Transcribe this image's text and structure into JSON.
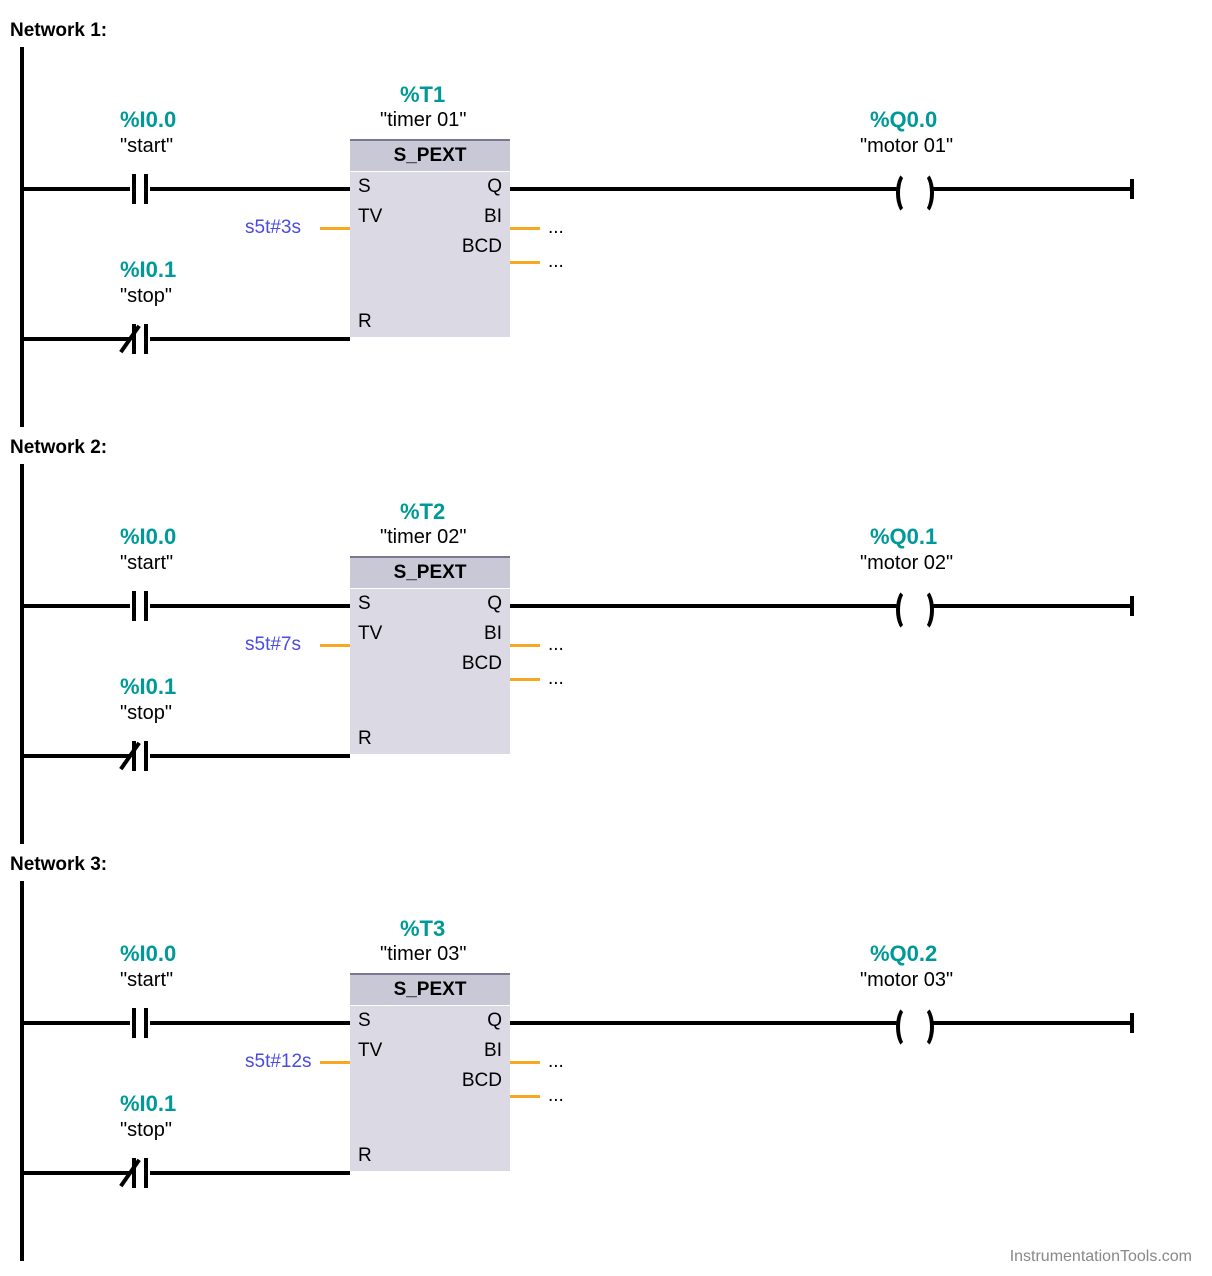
{
  "networks": [
    {
      "title": "Network 1:",
      "start": {
        "addr": "%I0.0",
        "name": "\"start\""
      },
      "stop": {
        "addr": "%I0.1",
        "name": "\"stop\""
      },
      "timer": {
        "addr": "%T1",
        "name": "\"timer 01\"",
        "type": "S_PEXT",
        "tv": "s5t#3s",
        "pins": {
          "s": "S",
          "q": "Q",
          "tv": "TV",
          "bi": "BI",
          "bcd": "BCD",
          "r": "R"
        },
        "dots": "..."
      },
      "coil": {
        "addr": "%Q0.0",
        "name": "\"motor 01\""
      }
    },
    {
      "title": "Network 2:",
      "start": {
        "addr": "%I0.0",
        "name": "\"start\""
      },
      "stop": {
        "addr": "%I0.1",
        "name": "\"stop\""
      },
      "timer": {
        "addr": "%T2",
        "name": "\"timer 02\"",
        "type": "S_PEXT",
        "tv": "s5t#7s",
        "pins": {
          "s": "S",
          "q": "Q",
          "tv": "TV",
          "bi": "BI",
          "bcd": "BCD",
          "r": "R"
        },
        "dots": "..."
      },
      "coil": {
        "addr": "%Q0.1",
        "name": "\"motor 02\""
      }
    },
    {
      "title": "Network 3:",
      "start": {
        "addr": "%I0.0",
        "name": "\"start\""
      },
      "stop": {
        "addr": "%I0.1",
        "name": "\"stop\""
      },
      "timer": {
        "addr": "%T3",
        "name": "\"timer 03\"",
        "type": "S_PEXT",
        "tv": "s5t#12s",
        "pins": {
          "s": "S",
          "q": "Q",
          "tv": "TV",
          "bi": "BI",
          "bcd": "BCD",
          "r": "R"
        },
        "dots": "..."
      },
      "coil": {
        "addr": "%Q0.2",
        "name": "\"motor 03\""
      }
    }
  ],
  "footer": "InstrumentationTools.com"
}
